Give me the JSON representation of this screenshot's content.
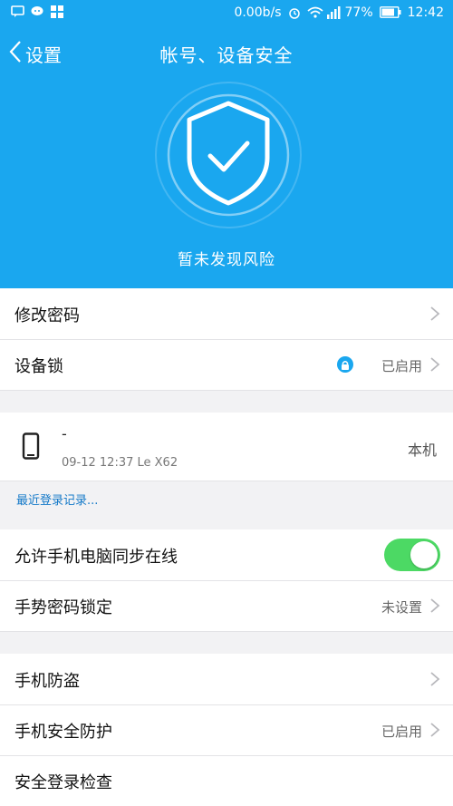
{
  "status_bar": {
    "network_speed": "0.00b/s",
    "battery": "77%",
    "time": "12:42",
    "icons": [
      "message-icon",
      "wechat-icon",
      "app-grid-icon",
      "alarm-icon",
      "wifi-icon",
      "signal-icon",
      "battery-icon"
    ]
  },
  "nav": {
    "back_label": "设置",
    "title": "帐号、设备安全"
  },
  "hero": {
    "status_text": "暂未发现风险",
    "accent_color": "#1aa7ef"
  },
  "settings": {
    "change_password": "修改密码",
    "device_lock": {
      "label": "设备锁",
      "value": "已启用"
    }
  },
  "device": {
    "name": "-",
    "last_login": "09-12 12:37 Le X62",
    "tag": "本机",
    "recent_logins_link": "最近登录记录..."
  },
  "sync": {
    "allow_sync": {
      "label": "允许手机电脑同步在线",
      "enabled": true
    },
    "gesture_lock": {
      "label": "手势密码锁定",
      "value": "未设置"
    }
  },
  "phone": {
    "anti_theft": "手机防盗",
    "security": {
      "label": "手机安全防护",
      "value": "已启用"
    },
    "login_check": "安全登录检查"
  }
}
